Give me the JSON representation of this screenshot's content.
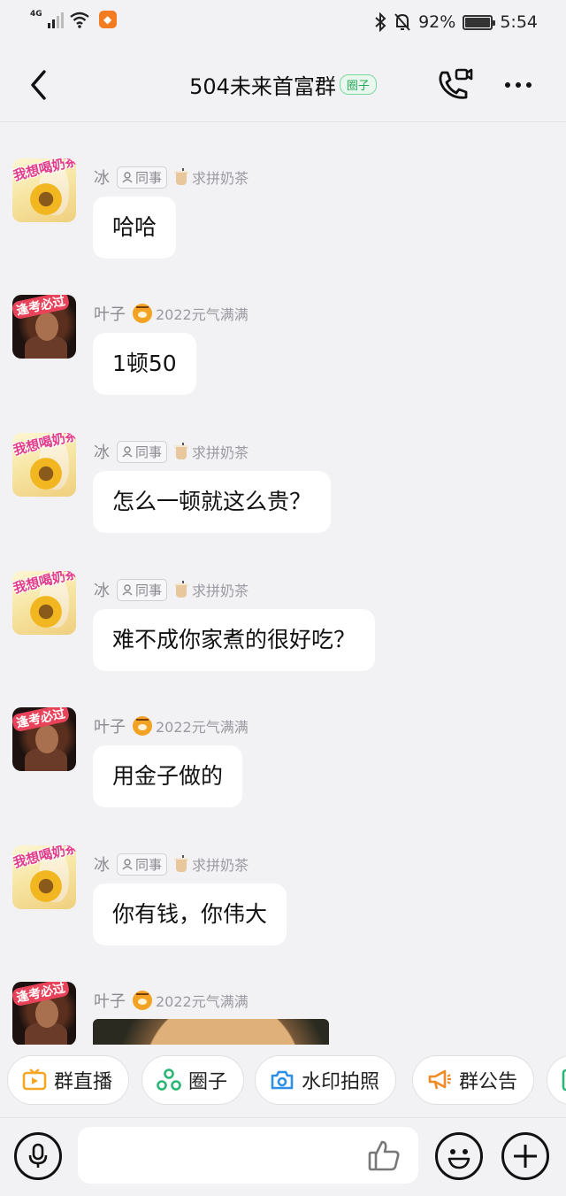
{
  "status_bar": {
    "network": "4G",
    "battery": "92%",
    "time": "5:54"
  },
  "header": {
    "title": "504未来首富群",
    "tag": "圈子",
    "back_icon": "chevron-left-icon",
    "call_icon": "video-call-icon",
    "more_icon": "more-dots-icon"
  },
  "messages": [
    {
      "sender": "冰",
      "role": "同事",
      "tag": "求拼奶茶",
      "sticker": "我想喝奶茶",
      "text": "哈哈"
    },
    {
      "sender": "叶子",
      "tag": "2022元气满满",
      "sticker": "逢考必过",
      "text": "1顿50"
    },
    {
      "sender": "冰",
      "role": "同事",
      "tag": "求拼奶茶",
      "sticker": "我想喝奶茶",
      "text": "怎么一顿就这么贵？"
    },
    {
      "sender": "冰",
      "role": "同事",
      "tag": "求拼奶茶",
      "sticker": "我想喝奶茶",
      "text": "难不成你家煮的很好吃？"
    },
    {
      "sender": "叶子",
      "tag": "2022元气满满",
      "sticker": "逢考必过",
      "text": "用金子做的"
    },
    {
      "sender": "冰",
      "role": "同事",
      "tag": "求拼奶茶",
      "sticker": "我想喝奶茶",
      "text": "你有钱，你伟大"
    },
    {
      "sender": "叶子",
      "tag": "2022元气满满",
      "sticker": "逢考必过",
      "text": ""
    }
  ],
  "quick_actions": [
    {
      "label": "群直播",
      "icon": "tv-icon",
      "color": "#f5a623"
    },
    {
      "label": "圈子",
      "icon": "circle-group-icon",
      "color": "#2bb673"
    },
    {
      "label": "水印拍照",
      "icon": "camera-icon",
      "color": "#2f8fe6"
    },
    {
      "label": "群公告",
      "icon": "megaphone-icon",
      "color": "#f08a24"
    }
  ],
  "input_bar": {
    "placeholder": "",
    "voice_icon": "microphone-icon",
    "like_icon": "thumbs-up-icon",
    "emoji_icon": "emoji-icon",
    "plus_icon": "plus-icon"
  }
}
